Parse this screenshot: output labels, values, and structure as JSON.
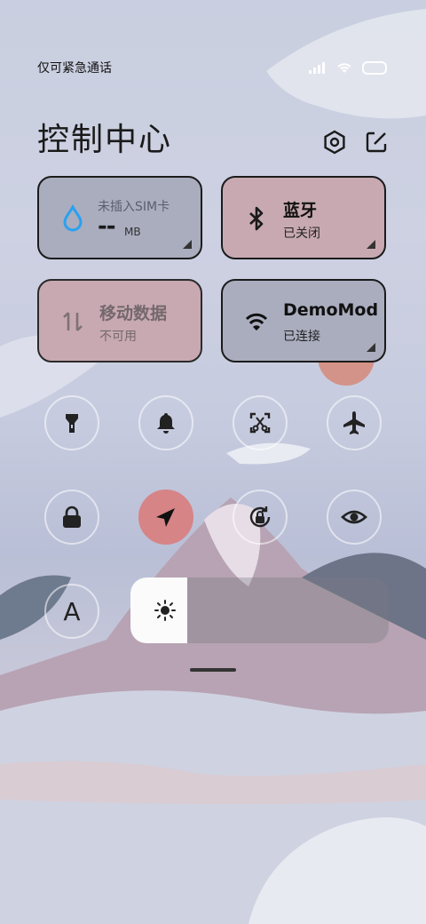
{
  "status_bar": {
    "carrier_text": "仅可紧急通话",
    "icons": [
      "signal-icon",
      "wifi-icon",
      "battery-icon"
    ]
  },
  "header": {
    "title": "控制中心",
    "settings_icon": "settings-icon",
    "edit_icon": "edit-icon"
  },
  "tiles": {
    "data_usage": {
      "line1": "未插入SIM卡",
      "value": "--",
      "unit": "MB",
      "icon": "water-drop-icon"
    },
    "bluetooth": {
      "title": "蓝牙",
      "status": "已关闭",
      "icon": "bluetooth-icon"
    },
    "mobile_data": {
      "title": "移动数据",
      "status": "不可用",
      "icon": "data-arrows-icon"
    },
    "wifi": {
      "title": "DemoMode",
      "status": "已连接",
      "icon": "wifi-icon"
    }
  },
  "toggles_row1": [
    {
      "name": "flashlight",
      "icon": "flashlight-icon"
    },
    {
      "name": "ring",
      "icon": "bell-icon"
    },
    {
      "name": "screenshot",
      "icon": "screenshot-icon"
    },
    {
      "name": "airplane",
      "icon": "airplane-icon"
    }
  ],
  "toggles_row2": [
    {
      "name": "lock",
      "icon": "lock-icon"
    },
    {
      "name": "location",
      "icon": "location-icon",
      "active": true
    },
    {
      "name": "rotation",
      "icon": "rotation-lock-icon"
    },
    {
      "name": "eye",
      "icon": "eye-icon"
    }
  ],
  "font_button": {
    "label": "A"
  },
  "brightness": {
    "level_fraction": 0.22,
    "icon": "sun-icon"
  },
  "colors": {
    "tile_red": "#c8a9b2",
    "tile_gray": "#a9adbe",
    "location_active": "#d68486",
    "drop_blue": "#2aa1f0"
  }
}
